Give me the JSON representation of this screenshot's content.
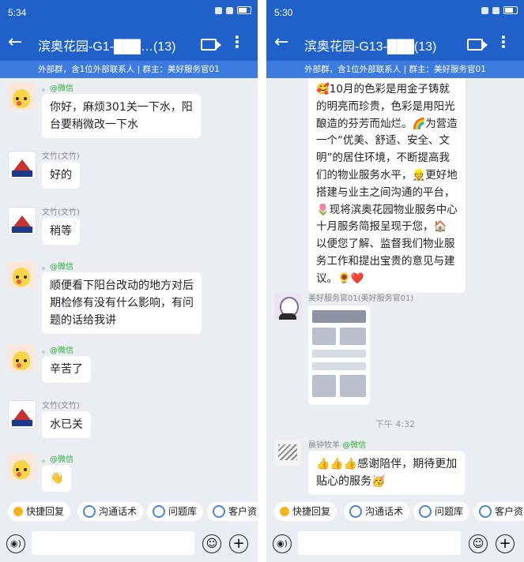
{
  "left": {
    "status_time": "5:34",
    "title": "滨奥花园-G1-███…(13)",
    "subtitle": "外部群，含1位外部联系人 | 群主：美好服务官01",
    "messages": [
      {
        "sender": "。@微信",
        "text": "你好，麻烦301关一下水，阳\n台要稍微改一下水"
      },
      {
        "sender": "文竹(文竹)",
        "text": "好的"
      },
      {
        "sender": "文竹(文竹)",
        "text": "稍等"
      },
      {
        "sender": "。@微信",
        "text": "顺便看下阳台改动的地方对后\n期检修有没有什么影响，有问\n题的话给我讲"
      },
      {
        "sender": "。@微信",
        "text": "辛苦了"
      },
      {
        "sender": "文竹(文竹)",
        "text": "水已关"
      },
      {
        "sender": "。@微信",
        "text": "👋"
      }
    ]
  },
  "right": {
    "status_time": "5:30",
    "title": "滨奥花园-G13-███(13)",
    "subtitle": "外部群，含1位外部联系人 | 群主：美好服务官01",
    "long_message": "🥰10月的色彩是用金子铸就\n的明亮而珍贵，色彩是用阳光\n酿造的芬芳而灿烂。🌈为营造\n一个“优美、舒适、安全、文\n明”的居住环境，不断提高我\n们的物业服务水平，👷更好地\n搭建与业主之间沟通的平台，\n🌷现将滨奥花园物业服务中心\n十月服务简报呈现于您，🏠\n以便您了解、监督我们物业服\n务工作和提出宝贵的意见与建\n议。🌻❤️",
    "image_sender": "美好服务官01(美好服务官01)",
    "time_separator": "下午 4:32",
    "last_sender": "晨钟牧羊",
    "last_sender_wx": "@微信",
    "last_message": "👍👍👍感谢陪伴，期待更加\n贴心的服务🥳"
  },
  "quick_bar": {
    "left": [
      "快捷回复",
      "沟通话术",
      "问题库",
      "客户资"
    ],
    "right": [
      "快捷回复",
      "沟通话术",
      "问题库",
      "客户资"
    ]
  },
  "icons": {
    "back": "←",
    "more": "⋮",
    "voice": "◉)",
    "emoji": "☺",
    "plus": "+"
  },
  "colors": {
    "header": "#1f61c8",
    "subbar": "#3e7be0",
    "wechat_tag": "#2eae3b",
    "chat_bg": "#eaedf2"
  }
}
